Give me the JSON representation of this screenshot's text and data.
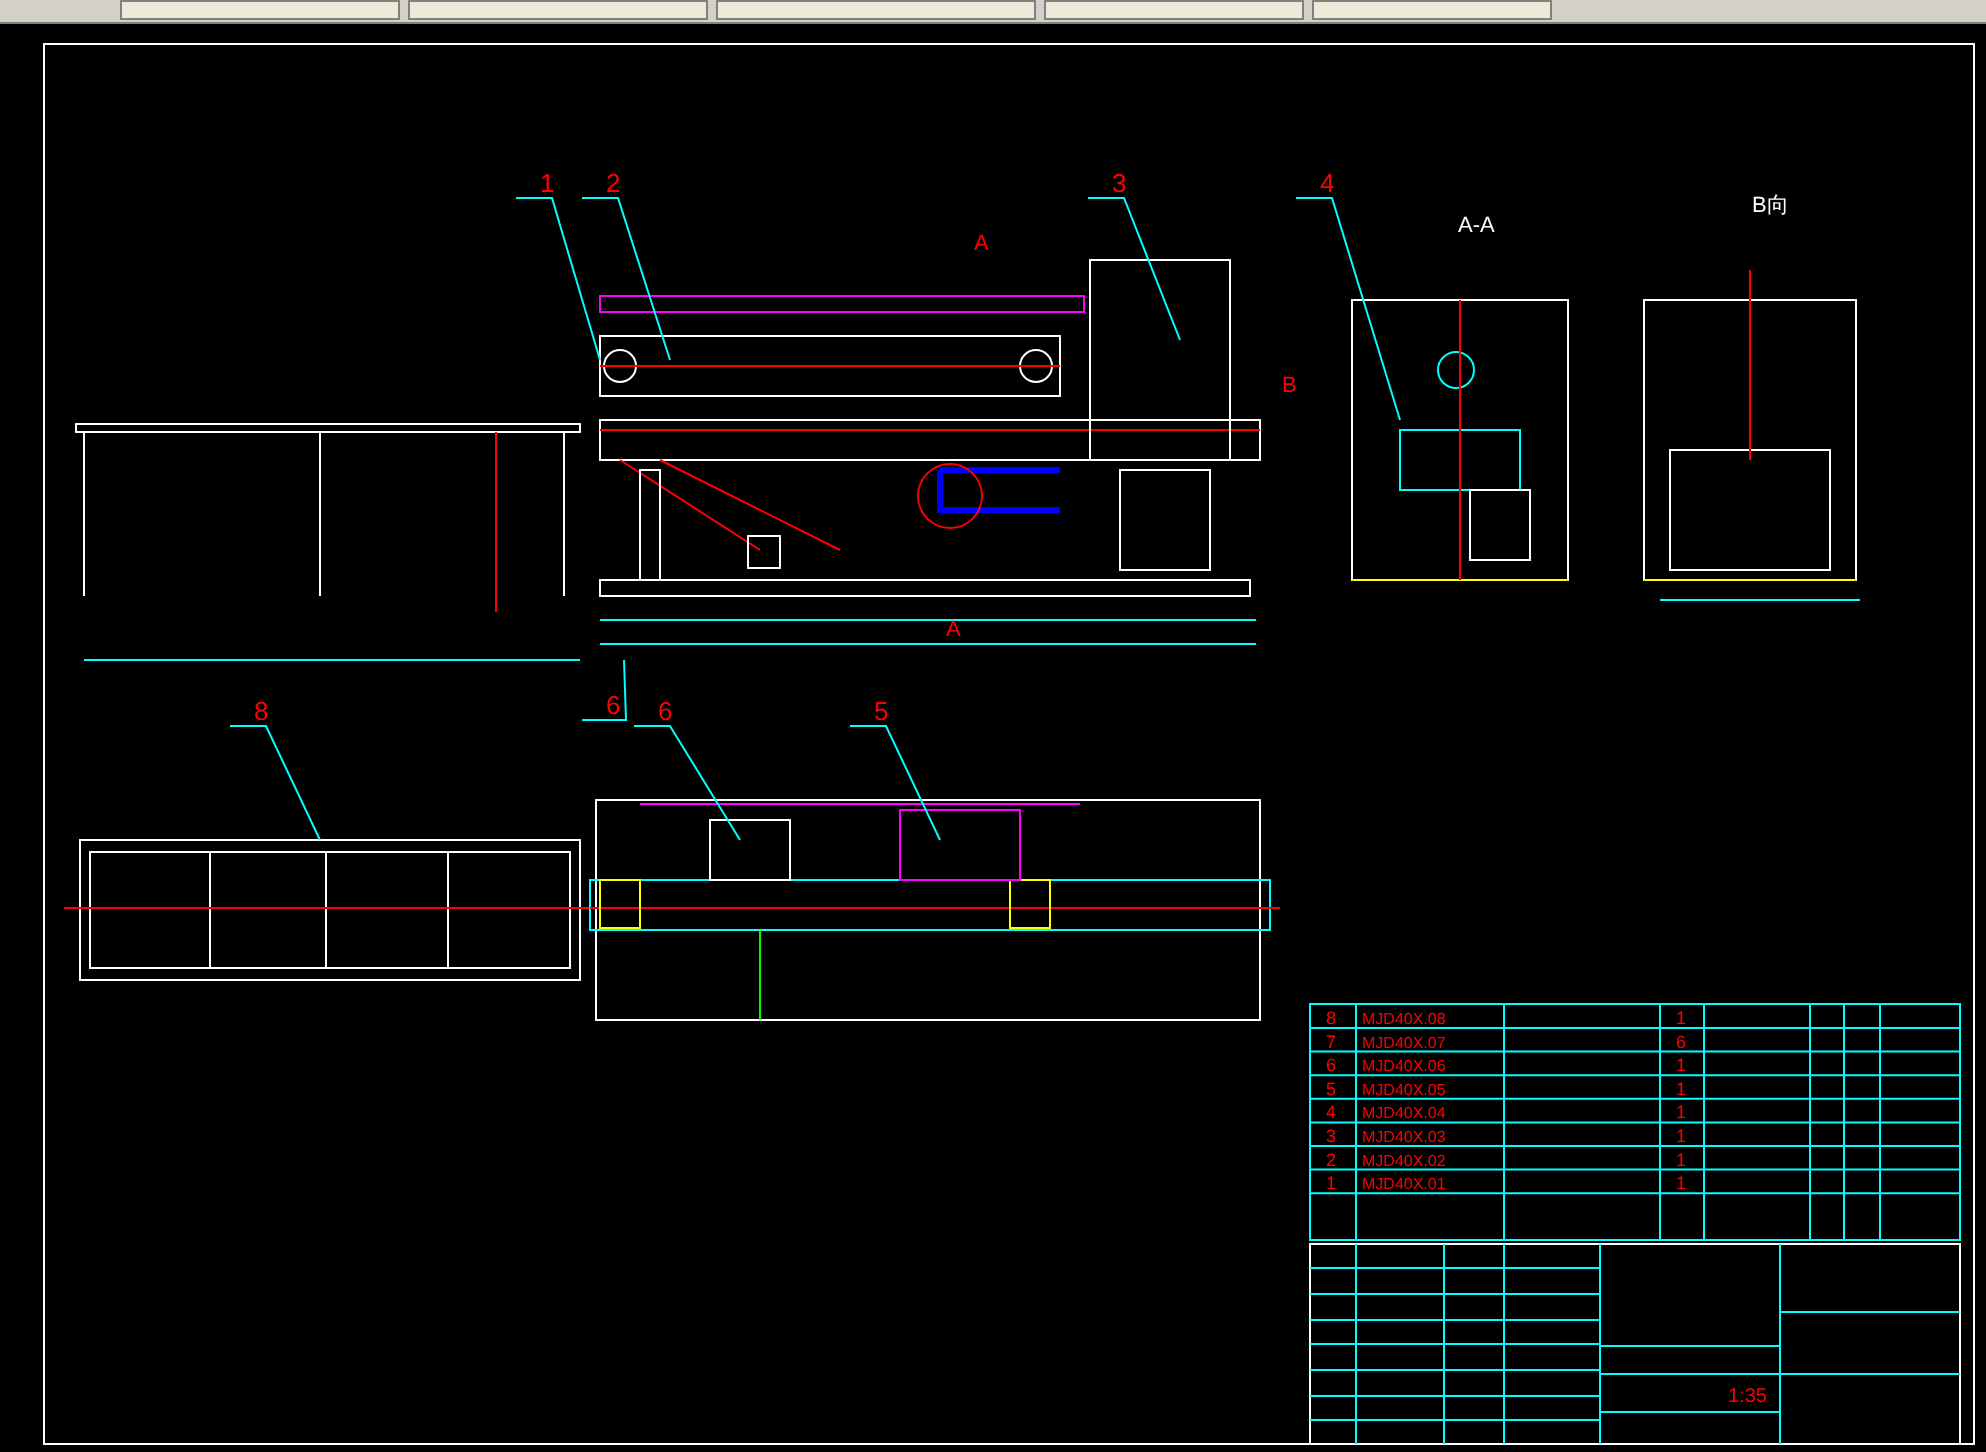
{
  "drawing": {
    "balloons": [
      {
        "label": "1"
      },
      {
        "label": "2"
      },
      {
        "label": "3"
      },
      {
        "label": "4"
      },
      {
        "label": "8"
      },
      {
        "label": "6"
      },
      {
        "label": "6"
      },
      {
        "label": "5"
      }
    ],
    "section_labels": [
      {
        "label": "A"
      },
      {
        "label": "A"
      },
      {
        "label": "A-A"
      },
      {
        "label": "B向"
      },
      {
        "label": "B"
      }
    ]
  },
  "parts_list": {
    "rows": [
      {
        "no": "8",
        "code": "MJD40X.08",
        "qty": "1"
      },
      {
        "no": "7",
        "code": "MJD40X.07",
        "qty": "6"
      },
      {
        "no": "6",
        "code": "MJD40X.06",
        "qty": "1"
      },
      {
        "no": "5",
        "code": "MJD40X.05",
        "qty": "1"
      },
      {
        "no": "4",
        "code": "MJD40X.04",
        "qty": "1"
      },
      {
        "no": "3",
        "code": "MJD40X.03",
        "qty": "1"
      },
      {
        "no": "2",
        "code": "MJD40X.02",
        "qty": "1"
      },
      {
        "no": "1",
        "code": "MJD40X.01",
        "qty": "1"
      }
    ]
  },
  "title_block": {
    "scale": "1:35"
  }
}
